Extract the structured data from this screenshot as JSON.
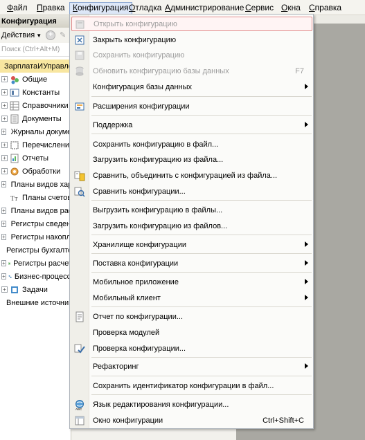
{
  "menubar": {
    "items": [
      "Файл",
      "Правка",
      "Конфигурация",
      "Отладка",
      "Администрирование",
      "Сервис",
      "Окна",
      "Справка"
    ]
  },
  "left_panel": {
    "title": "Конфигурация",
    "actions_label": "Действия",
    "search_placeholder": "Поиск (Ctrl+Alt+M)",
    "root": "ЗарплатаИУправлениеПерсоналом",
    "tree_items": [
      {
        "label": "Общие",
        "icon": "general-icon"
      },
      {
        "label": "Константы",
        "icon": "constants-icon"
      },
      {
        "label": "Справочники",
        "icon": "catalogs-icon"
      },
      {
        "label": "Документы",
        "icon": "documents-icon"
      },
      {
        "label": "Журналы документов",
        "icon": "journals-icon"
      },
      {
        "label": "Перечисления",
        "icon": "enums-icon"
      },
      {
        "label": "Отчеты",
        "icon": "reports-icon"
      },
      {
        "label": "Обработки",
        "icon": "processing-icon"
      },
      {
        "label": "Планы видов характеристик",
        "icon": "char-plans-icon"
      },
      {
        "label": "Планы счетов",
        "icon": "accounts-plans-icon"
      },
      {
        "label": "Планы видов расчета",
        "icon": "calc-plans-icon"
      },
      {
        "label": "Регистры сведений",
        "icon": "info-registers-icon"
      },
      {
        "label": "Регистры накопления",
        "icon": "accum-registers-icon"
      },
      {
        "label": "Регистры бухгалтерии",
        "icon": "accounting-registers-icon"
      },
      {
        "label": "Регистры расчета",
        "icon": "calc-registers-icon"
      },
      {
        "label": "Бизнес-процессы",
        "icon": "business-processes-icon"
      },
      {
        "label": "Задачи",
        "icon": "tasks-icon"
      },
      {
        "label": "Внешние источники данных",
        "icon": "external-sources-icon"
      }
    ]
  },
  "menu": {
    "items": [
      {
        "label": "Открыть конфигурацию",
        "disabled": true,
        "icon": "open-config-icon"
      },
      {
        "label": "Закрыть конфигурацию",
        "disabled": false,
        "icon": "close-config-icon"
      },
      {
        "label": "Сохранить конфигурацию",
        "disabled": true,
        "icon": "save-config-icon"
      },
      {
        "label": "Обновить конфигурацию базы данных",
        "disabled": true,
        "icon": "update-db-icon",
        "shortcut": "F7"
      },
      {
        "label": "Конфигурация базы данных",
        "disabled": false,
        "submenu": true
      },
      {
        "label": "Расширения конфигурации",
        "disabled": false,
        "icon": "extensions-icon"
      },
      {
        "label": "Поддержка",
        "disabled": false,
        "submenu": true
      },
      {
        "label": "Сохранить конфигурацию в файл...",
        "disabled": false
      },
      {
        "label": "Загрузить конфигурацию из файла...",
        "disabled": false
      },
      {
        "label": "Сравнить, объединить с конфигурацией из файла...",
        "disabled": false,
        "icon": "compare-merge-icon"
      },
      {
        "label": "Сравнить конфигурации...",
        "disabled": false,
        "icon": "compare-icon"
      },
      {
        "label": "Выгрузить конфигурацию в файлы...",
        "disabled": false
      },
      {
        "label": "Загрузить конфигурацию из файлов...",
        "disabled": false
      },
      {
        "label": "Хранилище конфигурации",
        "disabled": false,
        "submenu": true
      },
      {
        "label": "Поставка конфигурации",
        "disabled": false,
        "submenu": true
      },
      {
        "label": "Мобильное приложение",
        "disabled": false,
        "submenu": true
      },
      {
        "label": "Мобильный клиент",
        "disabled": false,
        "submenu": true
      },
      {
        "label": "Отчет по конфигурации...",
        "disabled": false,
        "icon": "report-icon"
      },
      {
        "label": "Проверка модулей",
        "disabled": false
      },
      {
        "label": "Проверка конфигурации...",
        "disabled": false,
        "icon": "check-config-icon"
      },
      {
        "label": "Рефакторинг",
        "disabled": false,
        "submenu": true
      },
      {
        "label": "Сохранить идентификатор конфигурации в файл...",
        "disabled": false
      },
      {
        "label": "Язык редактирования конфигурации...",
        "disabled": false,
        "icon": "language-icon"
      },
      {
        "label": "Окно конфигурации",
        "disabled": false,
        "icon": "config-window-icon",
        "shortcut": "Ctrl+Shift+C"
      }
    ]
  },
  "colors": {
    "highlight_border": "#e08c8c",
    "root_bg": "#f8e6a0",
    "right_bg": "#a9a8a2"
  }
}
